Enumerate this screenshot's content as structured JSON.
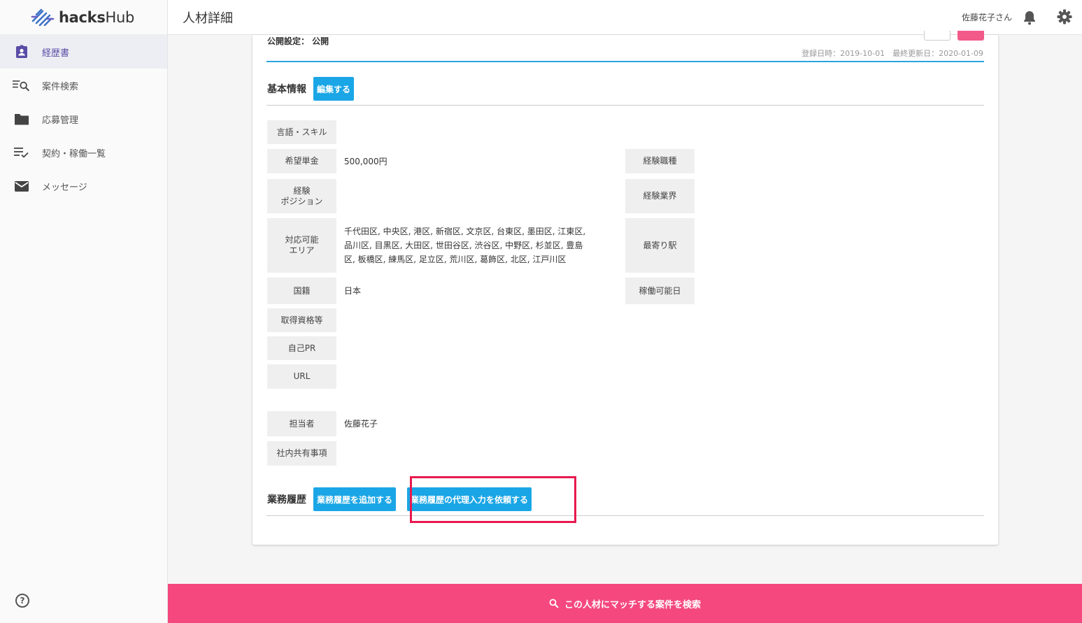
{
  "app": {
    "logo_bold": "hacks",
    "logo_light": "Hub"
  },
  "sidebar": {
    "items": [
      {
        "label": "経歴書",
        "icon": "badge-icon"
      },
      {
        "label": "案件検索",
        "icon": "list-search-icon"
      },
      {
        "label": "応募管理",
        "icon": "folder-icon"
      },
      {
        "label": "契約・稼働一覧",
        "icon": "checklist-icon"
      },
      {
        "label": "メッセージ",
        "icon": "mail-icon"
      }
    ],
    "help": "?"
  },
  "header": {
    "title": "人材詳細",
    "user": "佐藤花子さん"
  },
  "card": {
    "publish": "公開設定： 公開",
    "dates": "登録日時：2019-10-01　最終更新日：2020-01-09",
    "basic": {
      "title": "基本情報",
      "edit": "編集する"
    },
    "left_fields": [
      {
        "label": "言語・スキル",
        "value": ""
      },
      {
        "label": "希望単金",
        "value": "500,000円"
      },
      {
        "label": "経験\nポジション",
        "value": ""
      },
      {
        "label": "対応可能\nエリア",
        "value": "千代田区, 中央区, 港区, 新宿区, 文京区, 台東区, 墨田区, 江東区,\n品川区, 目黒区, 大田区, 世田谷区, 渋谷区, 中野区, 杉並区, 豊島\n区, 板橋区, 練馬区, 足立区, 荒川区, 葛飾区, 北区, 江戸川区"
      },
      {
        "label": "国籍",
        "value": "日本"
      },
      {
        "label": "取得資格等",
        "value": ""
      },
      {
        "label": "自己PR",
        "value": ""
      },
      {
        "label": "URL",
        "value": ""
      }
    ],
    "right_fields": [
      {
        "label": "経験職種",
        "value": ""
      },
      {
        "label": "経験業界",
        "value": ""
      },
      {
        "label": "最寄り駅",
        "value": ""
      },
      {
        "label": "稼働可能日",
        "value": ""
      }
    ],
    "staff_fields": [
      {
        "label": "担当者",
        "value": "佐藤花子"
      },
      {
        "label": "社内共有事項",
        "value": ""
      }
    ],
    "work": {
      "title": "業務履歴",
      "add": "業務履歴を追加する",
      "proxy": "業務履歴の代理入力を依頼する"
    }
  },
  "footer": {
    "search": "この人材にマッチする案件を検索"
  },
  "colors": {
    "accent_blue": "#1aa6e6",
    "pink": "#f5487f",
    "highlight": "#e8194f",
    "nav_active": "#5a4ca6"
  }
}
